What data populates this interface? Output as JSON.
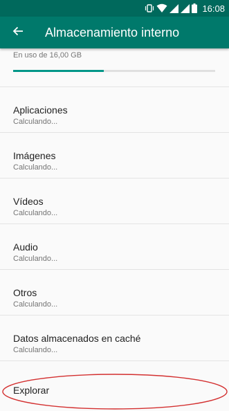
{
  "status_bar": {
    "time": "16:08",
    "icons": [
      "vibrate-icon",
      "wifi-icon",
      "signal-icon",
      "signal-icon",
      "battery-icon"
    ]
  },
  "app_bar": {
    "back_icon": "arrow-back-icon",
    "title": "Almacenamiento interno"
  },
  "usage": {
    "label": "En uso de 16,00 GB",
    "progress_fraction": 0.45
  },
  "items": [
    {
      "title": "Aplicaciones",
      "subtitle": "Calculando..."
    },
    {
      "title": "Imágenes",
      "subtitle": "Calculando..."
    },
    {
      "title": "Vídeos",
      "subtitle": "Calculando..."
    },
    {
      "title": "Audio",
      "subtitle": "Calculando..."
    },
    {
      "title": "Otros",
      "subtitle": "Calculando..."
    },
    {
      "title": "Datos almacenados en caché",
      "subtitle": "Calculando..."
    }
  ],
  "explore": {
    "label": "Explorar"
  },
  "colors": {
    "status_bar": "#00695c",
    "app_bar": "#00796b",
    "progress": "#009688",
    "annotation": "#d32f2f"
  }
}
